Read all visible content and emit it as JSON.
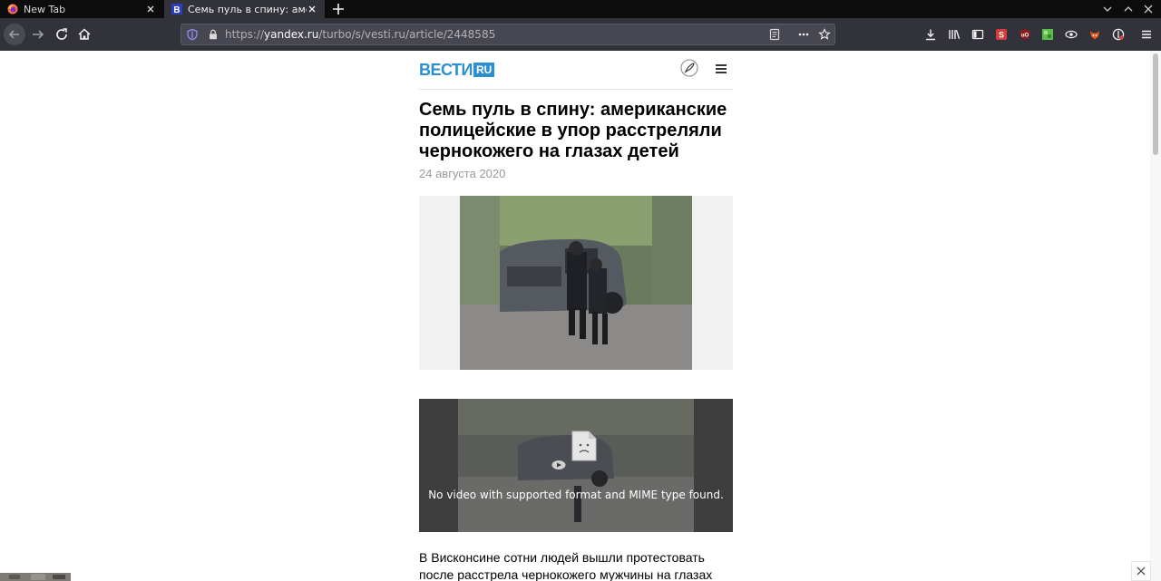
{
  "browser": {
    "tabs": [
      {
        "title": "New Tab",
        "icon": "firefox-icon",
        "active": false
      },
      {
        "title": "Семь пуль в спину: америк",
        "icon": "vesti-favicon-icon",
        "active": true
      }
    ],
    "url": {
      "prefix": "https://",
      "host": "yandex.ru",
      "path": "/turbo/s/vesti.ru/article/2448585"
    },
    "toolbar_icons": [
      "download-icon",
      "library-icon",
      "sidebar-icon",
      "extension-red-icon",
      "ublock-icon",
      "extension-green-icon",
      "extension-clover-icon",
      "extension-fox-icon",
      "extension-shield-icon",
      "menu-icon"
    ],
    "colors": {
      "tabbar": "#0c0c0d",
      "navbar": "#32323a",
      "urlbar": "#474751",
      "accent": "#2b8fd1"
    }
  },
  "site": {
    "logo_word": "ВЕСТИ",
    "logo_badge": "RU"
  },
  "article": {
    "headline": "Семь пуль в спину: американские полицейские в упор расстреляли чернокожего на глазах детей",
    "date": "24 августа 2020",
    "video_error": "No video with supported format and MIME type found.",
    "body_text": "В Висконсине сотни людей вышли протестовать после расстрела чернокожего мужчины на глазах его детей"
  }
}
